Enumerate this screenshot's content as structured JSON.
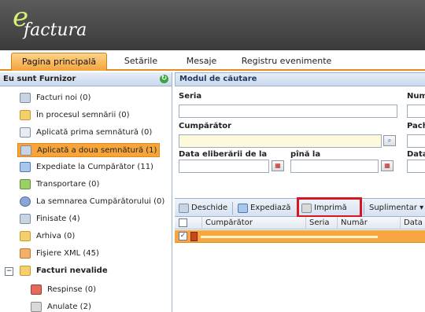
{
  "app": {
    "logo_e": "e",
    "logo_rest": "factura"
  },
  "menu": {
    "tabs": [
      {
        "label": "Pagina principală",
        "active": true
      },
      {
        "label": "Setările",
        "active": false
      },
      {
        "label": "Mesaje",
        "active": false
      },
      {
        "label": "Registru evenimente",
        "active": false
      }
    ]
  },
  "sidebar": {
    "title": "Eu sunt Furnizor",
    "items": [
      {
        "label": "Facturi noi (0)",
        "icon": "document-icon"
      },
      {
        "label": "În procesul semnării (0)",
        "icon": "folder-icon"
      },
      {
        "label": "Aplicată prima semnătură (0)",
        "icon": "signature-icon"
      },
      {
        "label": "Aplicată a doua semnătură (1)",
        "icon": "document-icon",
        "selected": true
      },
      {
        "label": "Expediate la Cumpărător (11)",
        "icon": "send-icon"
      },
      {
        "label": "Transportare (0)",
        "icon": "truck-icon"
      },
      {
        "label": "La semnarea Cumpărătorului (0)",
        "icon": "gear-icon"
      },
      {
        "label": "Finisate (4)",
        "icon": "document-icon"
      },
      {
        "label": "Arhiva (0)",
        "icon": "folder-icon"
      },
      {
        "label": "Fişiere XML (45)",
        "icon": "xml-icon"
      },
      {
        "label": "Facturi nevalide",
        "icon": "folder-icon",
        "expanded": true
      },
      {
        "label": "Respinse (0)",
        "icon": "reject-icon"
      },
      {
        "label": "Anulate (2)",
        "icon": "cancel-icon"
      }
    ],
    "expander_symbol": "−"
  },
  "search": {
    "title": "Modul de căutare",
    "seria_label": "Seria",
    "numar_label": "Num",
    "cumparator_label": "Cumpărător",
    "pachet_label": "Pach",
    "data_de_label": "Data eliberării de la",
    "data_pina_label": "pînă la",
    "data_right_label": "Data"
  },
  "toolbar": {
    "open_label": "Deschide",
    "send_label": "Expediază",
    "print_label": "Imprimă",
    "more_label": "Suplimentar ▾"
  },
  "grid": {
    "headers": [
      "Cumpărător",
      "Seria",
      "Număr",
      "Data"
    ],
    "check_mark": "✓",
    "rows": [
      {
        "checked": true
      }
    ]
  },
  "colors": {
    "accent": "#f3a33c",
    "highlight": "#d8161f",
    "header_bg": "#4a4a4a"
  }
}
